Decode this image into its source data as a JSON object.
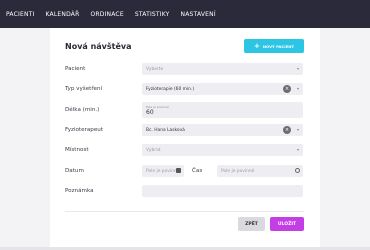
{
  "nav": {
    "items": [
      "PACIENTI",
      "KALENDÁŘ",
      "ORDINACE",
      "STATISTIKY",
      "NASTAVENÍ"
    ]
  },
  "form": {
    "title": "Nová návštěva",
    "new_patient_label": "NOVÝ PACIENT",
    "patient": {
      "label": "Pacient",
      "placeholder": "Vyberte"
    },
    "exam_type": {
      "label": "Typ vyšetření",
      "value": "Fyzioterapie (60 min.)"
    },
    "duration": {
      "label": "Délka (min.)",
      "hint": "Pole je povinné",
      "value": "60"
    },
    "therapist": {
      "label": "Fyzioterapeut",
      "value": "Bc. Hana Lasková"
    },
    "room": {
      "label": "Místnost",
      "placeholder": "Vybrat"
    },
    "date": {
      "label": "Datum",
      "placeholder": "Pole je povinné"
    },
    "time": {
      "label": "Čas",
      "placeholder": "Pole je povinné"
    },
    "note": {
      "label": "Poznámka"
    },
    "back_label": "ZPĚT",
    "save_label": "ULOŽIT"
  },
  "colors": {
    "nav_bg": "#2b2a3b",
    "accent_cyan": "#2cc6e4",
    "accent_purple": "#c43ee6"
  }
}
